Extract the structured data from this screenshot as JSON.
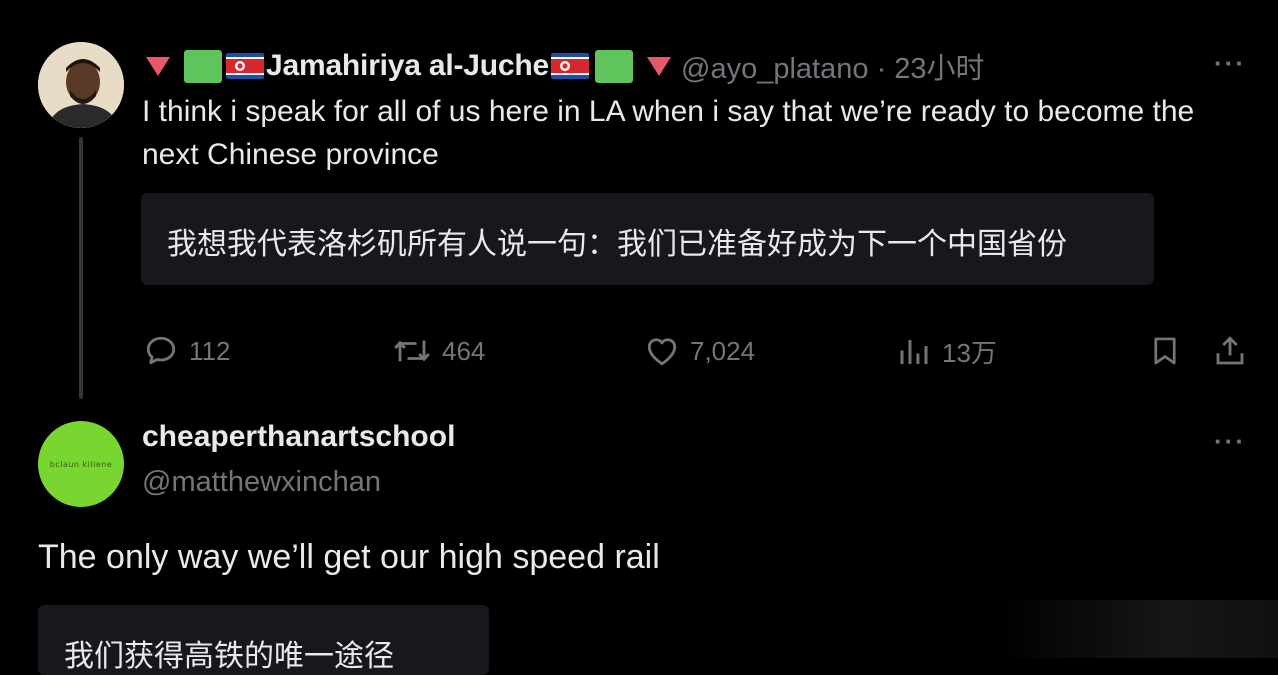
{
  "tweet1": {
    "display_name": "Jamahiriya al-Juche",
    "handle": "@ayo_platano",
    "separator": "·",
    "time": "23小时",
    "more": "···",
    "text": "I think i speak for all of us here in LA when i say that we’re ready to become the next Chinese province",
    "translation": "我想我代表洛杉矶所有人说一句：我们已准备好成为下一个中国省份",
    "actions": {
      "replies": "112",
      "reposts": "464",
      "likes": "7,024",
      "views": "13万"
    }
  },
  "tweet2": {
    "display_name": "cheaperthanartschool",
    "handle": "@matthewxinchan",
    "more": "···",
    "avatar_text": "bclaun kiliene",
    "text": "The only way we’ll get our high speed rail",
    "translation": "我们获得高铁的唯一途径"
  },
  "colors": {
    "background": "#000000",
    "primary_text": "#e7e9ea",
    "secondary_text": "#71767b",
    "translation_bg": "#16181c",
    "emoji_triangle": "#e8586b",
    "emoji_green": "#5fc45c",
    "avatar2_bg": "#79d630"
  },
  "icons": {
    "reply": "speech-bubble-icon",
    "repost": "repost-arrows-icon",
    "like": "heart-icon",
    "views": "bar-chart-icon",
    "bookmark": "bookmark-icon",
    "share": "share-upload-icon",
    "flag": "north-korea-flag-icon"
  }
}
